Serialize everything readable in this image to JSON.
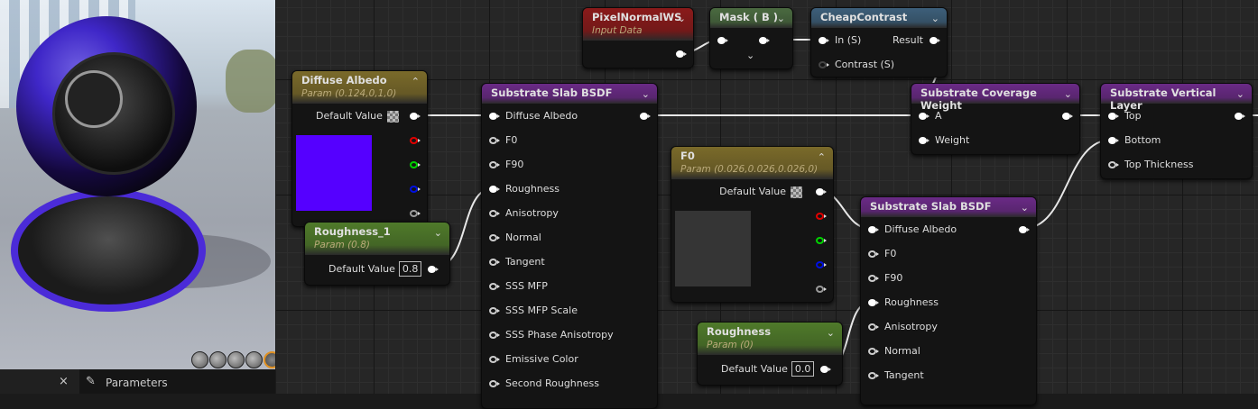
{
  "viewport": {
    "preview_icons": [
      "cylinder-icon",
      "sphere-icon",
      "plane-icon",
      "cube-icon",
      "mesh-icon"
    ]
  },
  "bottom_bar": {
    "close_label": "×",
    "tab_label": "Parameters"
  },
  "colors": {
    "diffuse_albedo_swatch": "#5500ff",
    "f0_swatch": "#353535",
    "param_header": "#7a6a2a",
    "scalar_header": "#4f7a2a",
    "substrate_header": "#6a2a86",
    "function_header": "#3d5f7a",
    "input_header": "#8a1a1a"
  },
  "nodes": {
    "pixelnormal": {
      "title": "PixelNormalWS",
      "subtitle": "Input Data"
    },
    "mask": {
      "title": "Mask ( B )"
    },
    "cheapcontrast": {
      "title": "CheapContrast",
      "inputs": [
        "In (S)",
        "Contrast (S)"
      ],
      "output": "Result"
    },
    "diffuse": {
      "title": "Diffuse Albedo",
      "subtitle": "Param (0.124,0,1,0)",
      "default_label": "Default Value"
    },
    "rough1": {
      "title": "Roughness_1",
      "subtitle": "Param (0.8)",
      "default_label": "Default Value",
      "value": "0.8"
    },
    "slab1": {
      "title": "Substrate Slab BSDF",
      "inputs": [
        "Diffuse Albedo",
        "F0",
        "F90",
        "Roughness",
        "Anisotropy",
        "Normal",
        "Tangent",
        "SSS MFP",
        "SSS MFP Scale",
        "SSS Phase Anisotropy",
        "Emissive Color",
        "Second Roughness"
      ]
    },
    "f0": {
      "title": "F0",
      "subtitle": "Param (0.026,0.026,0.026,0)",
      "default_label": "Default Value"
    },
    "slab2": {
      "title": "Substrate Slab BSDF",
      "inputs": [
        "Diffuse Albedo",
        "F0",
        "F90",
        "Roughness",
        "Anisotropy",
        "Normal",
        "Tangent"
      ]
    },
    "rough0": {
      "title": "Roughness",
      "subtitle": "Param (0)",
      "default_label": "Default Value",
      "value": "0.0"
    },
    "coverage": {
      "title": "Substrate Coverage Weight",
      "inputs": [
        "A",
        "Weight"
      ]
    },
    "vertical": {
      "title": "Substrate Vertical Layer",
      "inputs": [
        "Top",
        "Bottom",
        "Top Thickness"
      ]
    }
  }
}
